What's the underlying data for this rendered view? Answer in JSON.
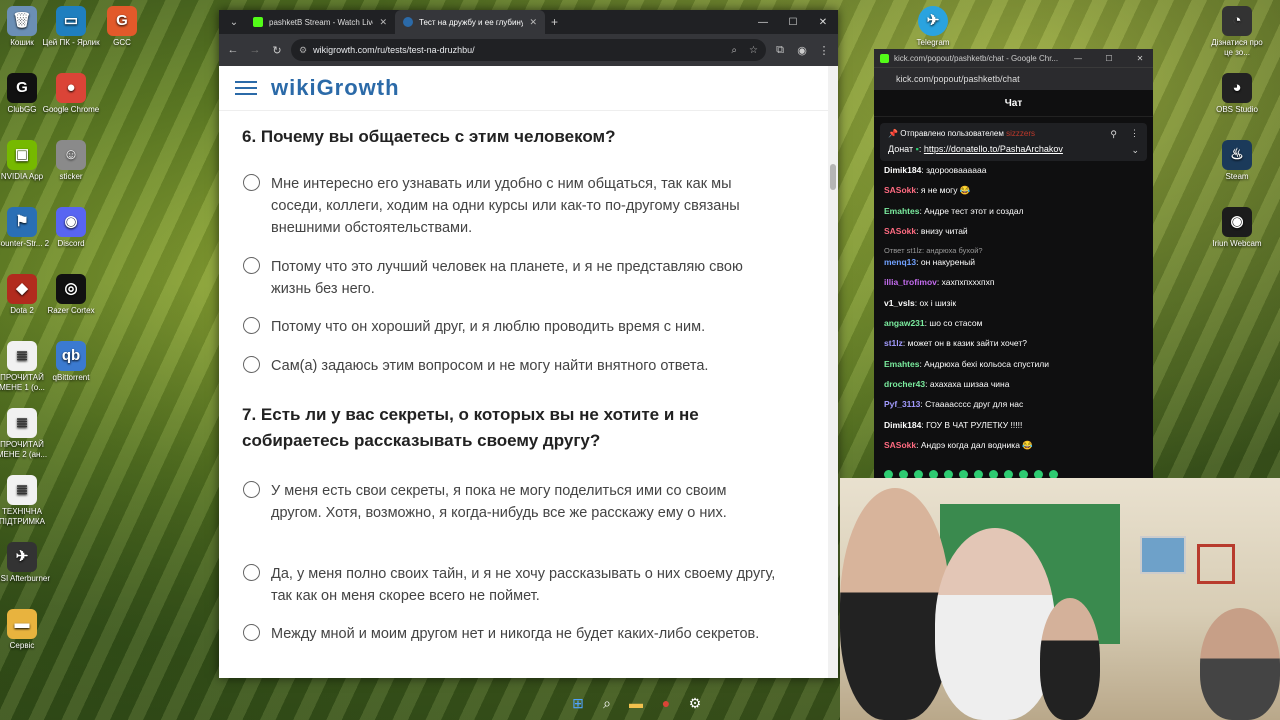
{
  "desktop": {
    "icons_left": [
      {
        "label": "Кошик",
        "glyph": "🗑",
        "color": "#6b8fb5"
      },
      {
        "label": "ClubGG",
        "glyph": "G",
        "color": "#111111"
      },
      {
        "label": "NVIDIA App",
        "glyph": "▣",
        "color": "#76b900"
      },
      {
        "label": "Counter-Str... 2",
        "glyph": "⚑",
        "color": "#2a6fb5"
      },
      {
        "label": "Dota 2",
        "glyph": "◆",
        "color": "#b22b1e"
      },
      {
        "label": "ПРОЧИТАЙ МЕНЕ 1 (о...",
        "glyph": "≣",
        "color": "#f1f1f1"
      },
      {
        "label": "ПРОЧИТАЙ МЕНЕ 2 (ан...",
        "glyph": "≣",
        "color": "#f1f1f1"
      },
      {
        "label": "ТЕХНІЧНА ПІДТРИМКА",
        "glyph": "≣",
        "color": "#f1f1f1"
      },
      {
        "label": "MSI Afterburner",
        "glyph": "✈",
        "color": "#333333"
      },
      {
        "label": "Сервіс",
        "glyph": "▬",
        "color": "#e8b33e"
      }
    ],
    "icons_left2": [
      {
        "label": "Цей ПК - Ярлик",
        "glyph": "▭",
        "color": "#1f7fbf"
      },
      {
        "label": "Google Chrome",
        "glyph": "●",
        "color": "#db4437"
      },
      {
        "label": "sticker",
        "glyph": "☺",
        "color": "#8a8a8a"
      },
      {
        "label": "Discord",
        "glyph": "◉",
        "color": "#5865f2"
      },
      {
        "label": "Razer Cortex",
        "glyph": "◎",
        "color": "#111111"
      },
      {
        "label": "qBittorrent",
        "glyph": "qb",
        "color": "#3b7ad0"
      }
    ],
    "icon_gcc": {
      "label": "GCC",
      "glyph": "G",
      "color": "#e2592a"
    },
    "icon_telegram": {
      "label": "Telegram",
      "glyph": "✈",
      "color": "#2aa3df"
    },
    "icons_right": [
      {
        "label": "Дізнатися про це зо...",
        "glyph": "◔",
        "color": "#333333"
      },
      {
        "label": "OBS Studio",
        "glyph": "◕",
        "color": "#222222"
      },
      {
        "label": "Steam",
        "glyph": "♨",
        "color": "#1b3a5a"
      },
      {
        "label": "Iriun Webcam",
        "glyph": "◉",
        "color": "#1c1c1c"
      }
    ]
  },
  "browser": {
    "tabs": [
      {
        "title": "pashketB Stream - Watch Live o",
        "fav_color": "#53fc18"
      },
      {
        "title": "Тест на дружбу и ее глубину",
        "fav_color": "#2b6aa8"
      }
    ],
    "url": "wikigrowth.com/ru/tests/test-na-druzhbu/",
    "site_logo": "wikiGrowth"
  },
  "quiz": {
    "q6": {
      "title": "6. Почему вы общаетесь с этим человеком?",
      "options": [
        "Мне интересно его узнавать или удобно с ним общаться, так как мы соседи, коллеги, ходим на одни курсы или как-то по-другому связаны внешними обстоятельствами.",
        "Потому что это лучший человек на планете, и я не представляю свою жизнь без него.",
        "Потому что он хороший друг, и я люблю проводить время с ним.",
        "Сам(а) задаюсь этим вопросом и не могу найти внятного ответа."
      ]
    },
    "q7": {
      "title": "7. Есть ли у вас секреты, о которых вы не хотите и не собираетесь рассказывать своему другу?",
      "options": [
        "У меня есть свои секреты, я пока не могу поделиться ими со своим другом. Хотя, возможно, я когда-нибудь все же расскажу ему о них.",
        "Да, у меня полно своих тайн, и я не хочу рассказывать о них своему другу, так как он меня скорее всего не поймет.",
        "Между мной и моим другом нет и никогда не будет каких-либо секретов."
      ]
    }
  },
  "chat": {
    "window_title": "kick.com/popout/pashketb/chat - Google Chr...",
    "address": "kick.com/popout/pashketb/chat",
    "header": "Чат",
    "pinned": {
      "prefix": "Отправлено пользователем",
      "user": "sizzzers",
      "donat_label": "Донат",
      "link": "https://donatello.to/PashaArchakov"
    },
    "messages": [
      {
        "user": "Dimik184",
        "color": "#ffffff",
        "text": "здорооваааааа"
      },
      {
        "user": "SASokk",
        "color": "#ff6b81",
        "text": "я не могу 😂"
      },
      {
        "user": "Emahtes",
        "color": "#7bed9f",
        "text": "Андре тест этот и создал"
      },
      {
        "user": "SASokk",
        "color": "#ff6b81",
        "text": "внизу читай"
      },
      {
        "reply": "Ответ st1lz: андрюха бухой?",
        "user": "menq13",
        "color": "#70a1ff",
        "text": "он накуреный"
      },
      {
        "user": "illia_trofimov",
        "color": "#c56cf0",
        "text": "хахпхпхххпхп"
      },
      {
        "user": "v1_vsls",
        "color": "#ffffff",
        "text": "ох і шизік"
      },
      {
        "user": "angaw231",
        "color": "#7bed9f",
        "text": "шо со стасом"
      },
      {
        "user": "st1lz",
        "color": "#a29bfe",
        "text": "может он в казик зайти хочет?"
      },
      {
        "user": "Emahtes",
        "color": "#7bed9f",
        "text": "Андрюха бехі кольоса спустили"
      },
      {
        "user": "drocher43",
        "color": "#7bed9f",
        "text": "ахахаха шизаа чина"
      },
      {
        "user": "Pyf_3113",
        "color": "#a29bfe",
        "text": "Стааааcссс друг для нас"
      },
      {
        "user": "Dimik184",
        "color": "#ffffff",
        "text": "ГОУ В ЧАТ РУЛЕТКУ !!!!!"
      },
      {
        "user": "SASokk",
        "color": "#ff6b81",
        "text": "Андрэ когда дал водника 😂"
      }
    ]
  }
}
